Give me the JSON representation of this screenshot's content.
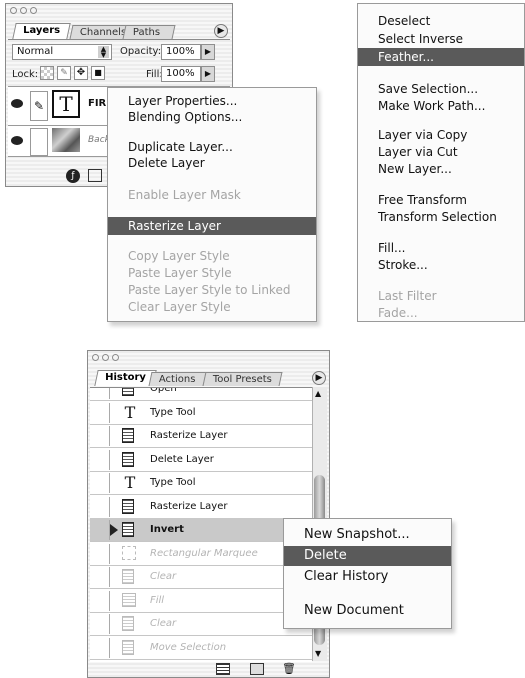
{
  "layers_panel": {
    "tabs": [
      "Layers",
      "Channels",
      "Paths"
    ],
    "blend_mode": "Normal",
    "opacity_label": "Opacity:",
    "opacity_value": "100%",
    "lock_label": "Lock:",
    "fill_label": "Fill:",
    "fill_value": "100%",
    "layers": [
      {
        "name": "FIR",
        "thumb": "T"
      },
      {
        "name": "Backgro"
      }
    ]
  },
  "layer_context_menu": {
    "items": [
      {
        "label": "Layer Properties...",
        "state": "enabled"
      },
      {
        "label": "Blending Options...",
        "state": "enabled"
      },
      {
        "label": "Duplicate Layer...",
        "state": "enabled"
      },
      {
        "label": "Delete Layer",
        "state": "enabled"
      },
      {
        "label": "Enable Layer Mask",
        "state": "disabled"
      },
      {
        "label": "Rasterize Layer",
        "state": "selected"
      },
      {
        "label": "Copy Layer Style",
        "state": "disabled"
      },
      {
        "label": "Paste Layer Style",
        "state": "disabled"
      },
      {
        "label": "Paste Layer Style to Linked",
        "state": "disabled"
      },
      {
        "label": "Clear Layer Style",
        "state": "disabled"
      }
    ]
  },
  "selection_menu": {
    "items": [
      {
        "label": "Deselect",
        "state": "enabled"
      },
      {
        "label": "Select Inverse",
        "state": "enabled"
      },
      {
        "label": "Feather...",
        "state": "selected"
      },
      {
        "label": "Save Selection...",
        "state": "enabled"
      },
      {
        "label": "Make Work Path...",
        "state": "enabled"
      },
      {
        "label": "Layer via Copy",
        "state": "enabled"
      },
      {
        "label": "Layer via Cut",
        "state": "enabled"
      },
      {
        "label": "New Layer...",
        "state": "enabled"
      },
      {
        "label": "Free Transform",
        "state": "enabled"
      },
      {
        "label": "Transform Selection",
        "state": "enabled"
      },
      {
        "label": "Fill...",
        "state": "enabled"
      },
      {
        "label": "Stroke...",
        "state": "enabled"
      },
      {
        "label": "Last Filter",
        "state": "disabled"
      },
      {
        "label": "Fade...",
        "state": "disabled"
      }
    ]
  },
  "history_panel": {
    "tabs": [
      "History",
      "Actions",
      "Tool Presets"
    ],
    "rows": [
      {
        "label": "Open",
        "icon": "doc",
        "state": "enabled"
      },
      {
        "label": "Type Tool",
        "icon": "T",
        "state": "enabled"
      },
      {
        "label": "Rasterize Layer",
        "icon": "doc",
        "state": "enabled"
      },
      {
        "label": "Delete Layer",
        "icon": "doc",
        "state": "enabled"
      },
      {
        "label": "Type Tool",
        "icon": "T",
        "state": "enabled"
      },
      {
        "label": "Rasterize Layer",
        "icon": "doc",
        "state": "enabled"
      },
      {
        "label": "Invert",
        "icon": "doc",
        "state": "current"
      },
      {
        "label": "Rectangular Marquee",
        "icon": "marquee",
        "state": "disabled"
      },
      {
        "label": "Clear",
        "icon": "doc",
        "state": "disabled"
      },
      {
        "label": "Fill",
        "icon": "fill",
        "state": "disabled"
      },
      {
        "label": "Clear",
        "icon": "doc",
        "state": "disabled"
      },
      {
        "label": "Move Selection",
        "icon": "doc",
        "state": "disabled"
      }
    ]
  },
  "history_context_menu": {
    "items": [
      {
        "label": "New Snapshot...",
        "state": "enabled"
      },
      {
        "label": "Delete",
        "state": "selected"
      },
      {
        "label": "Clear History",
        "state": "enabled"
      },
      {
        "label": "New Document",
        "state": "enabled"
      }
    ]
  }
}
